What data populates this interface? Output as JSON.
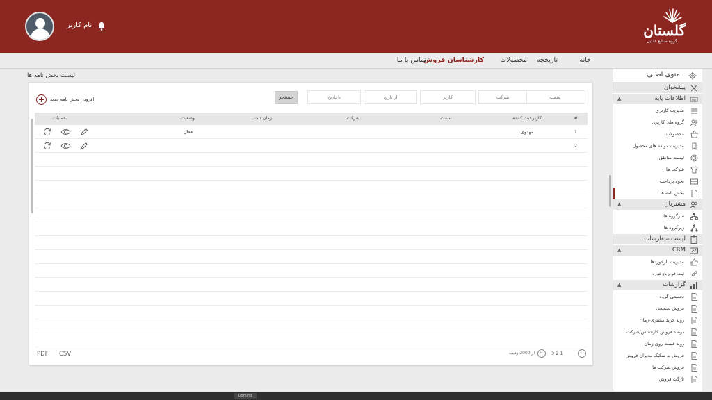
{
  "header": {
    "brand_name": "گلستان",
    "brand_subtitle": "گروه صنایع غذایی",
    "username": "نام کاربر"
  },
  "topnav": {
    "items": [
      "خانه",
      "تاریخچه",
      "محصولات",
      "کارشناسان فروش",
      "تماس با ما"
    ],
    "active": "کارشناسان فروش"
  },
  "page": {
    "title": "لیست بخش نامه ها"
  },
  "filters": {
    "semat": "سمت",
    "company": "شرکت",
    "user": "کاربر",
    "from_date": "از تاریخ",
    "to_date": "تا تاریخ",
    "search_button": "جستجو",
    "add_new": "افزودن بخش نامه جدید"
  },
  "table": {
    "columns": [
      "#",
      "کاربر ثبت کننده",
      "سمت",
      "شرکت",
      "زمان ثبت",
      "وضعیت",
      "عملیات"
    ],
    "rows": [
      {
        "num": "1",
        "user": "مهدوی",
        "semat": "",
        "company": "",
        "time": "",
        "status": "فعال"
      },
      {
        "num": "2",
        "user": "",
        "semat": "",
        "company": "",
        "time": "",
        "status": ""
      }
    ]
  },
  "footer": {
    "pdf": "PDF",
    "csv": "CSV",
    "pages": "1  2  3",
    "total": "از 2000 ردیف"
  },
  "sidebar": {
    "title": "منوی اصلی",
    "sections": [
      {
        "label": "پیشخوان",
        "icon": "tools-icon",
        "items": []
      },
      {
        "label": "اطلاعات پایه",
        "icon": "keyboard-icon",
        "items": [
          {
            "label": "مدیریت کاربری",
            "icon": "sliders-icon"
          },
          {
            "label": "گروه های کاربری",
            "icon": "users-icon"
          },
          {
            "label": "محصولات",
            "icon": "basket-icon"
          },
          {
            "label": "مدیریت مولفه های محصول",
            "icon": "bookmark-icon"
          },
          {
            "label": "لیست مناطق",
            "icon": "target-icon"
          },
          {
            "label": "شرکت ها",
            "icon": "shirt-icon"
          },
          {
            "label": "نحوه پرداخت",
            "icon": "card-icon"
          },
          {
            "label": "بخش نامه ها",
            "icon": "document-icon",
            "active": true
          }
        ]
      },
      {
        "label": "مشتریان",
        "icon": "customers-icon",
        "items": [
          {
            "label": "سرگروه ها",
            "icon": "hierarchy-icon"
          },
          {
            "label": "زیرگروه ها",
            "icon": "subgroup-icon"
          }
        ]
      },
      {
        "label": "لیست سفارشات",
        "icon": "clipboard-icon",
        "items": []
      },
      {
        "label": "CRM",
        "icon": "crm-icon",
        "items": [
          {
            "label": "مدیریت بازخوردها",
            "icon": "thumbs-icon"
          },
          {
            "label": "ثبت فرم بازخورد",
            "icon": "paperclip-icon"
          }
        ]
      },
      {
        "label": "گزارشات",
        "icon": "reports-icon",
        "items": [
          {
            "label": "تجمیعی گروه",
            "icon": "report-doc-icon"
          },
          {
            "label": "فروش تجمیعی",
            "icon": "report-doc-icon"
          },
          {
            "label": "روند خرید مشتری-زمان",
            "icon": "report-doc-icon"
          },
          {
            "label": "درصد فروش کارشناس/شرکت",
            "icon": "report-doc-icon"
          },
          {
            "label": "روند قیمت روی زمان",
            "icon": "report-doc-icon"
          },
          {
            "label": "فروش به تفکیک مدیران فروش",
            "icon": "report-doc-icon"
          },
          {
            "label": "فروش شرکت ها",
            "icon": "report-doc-icon"
          },
          {
            "label": "تارگت فروش",
            "icon": "report-doc-icon"
          }
        ]
      }
    ]
  },
  "bottom": {
    "brand": "Domino"
  }
}
